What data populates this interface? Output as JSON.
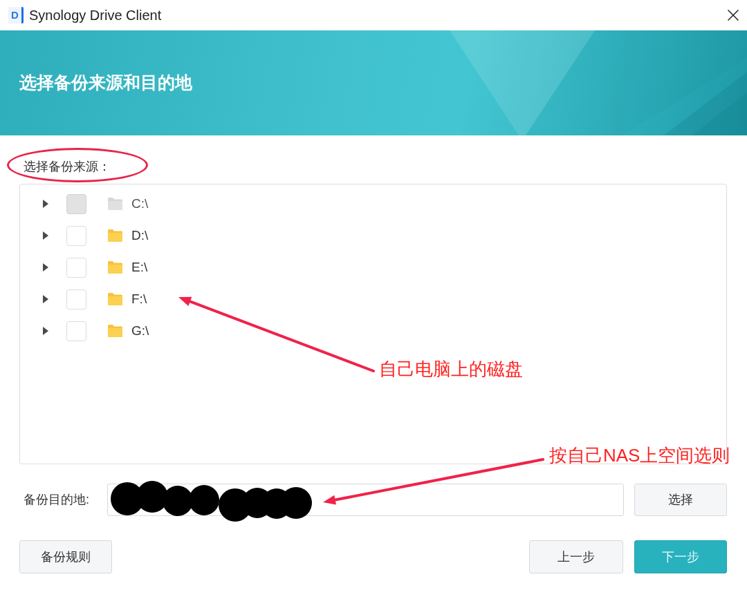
{
  "window": {
    "logo_text": "D",
    "title": "Synology Drive Client"
  },
  "header": {
    "title": "选择备份来源和目的地"
  },
  "source": {
    "label": "选择备份来源：",
    "items": [
      {
        "label": "C:\\",
        "expanded": false,
        "checked": false,
        "disabled": true
      },
      {
        "label": "D:\\",
        "expanded": false,
        "checked": false,
        "disabled": false
      },
      {
        "label": "E:\\",
        "expanded": false,
        "checked": false,
        "disabled": false
      },
      {
        "label": "F:\\",
        "expanded": false,
        "checked": false,
        "disabled": false
      },
      {
        "label": "G:\\",
        "expanded": false,
        "checked": false,
        "disabled": false
      }
    ]
  },
  "destination": {
    "label": "备份目的地:",
    "button": "选择"
  },
  "buttons": [
    {
      "label": "备份规则",
      "kind": "default"
    },
    {
      "label": "上一步",
      "kind": "default"
    },
    {
      "label": "下一步",
      "kind": "primary"
    }
  ],
  "annotations": [
    {
      "text": "自己电脑上的磁盘"
    },
    {
      "text": "按自己NAS上空间选则"
    }
  ]
}
